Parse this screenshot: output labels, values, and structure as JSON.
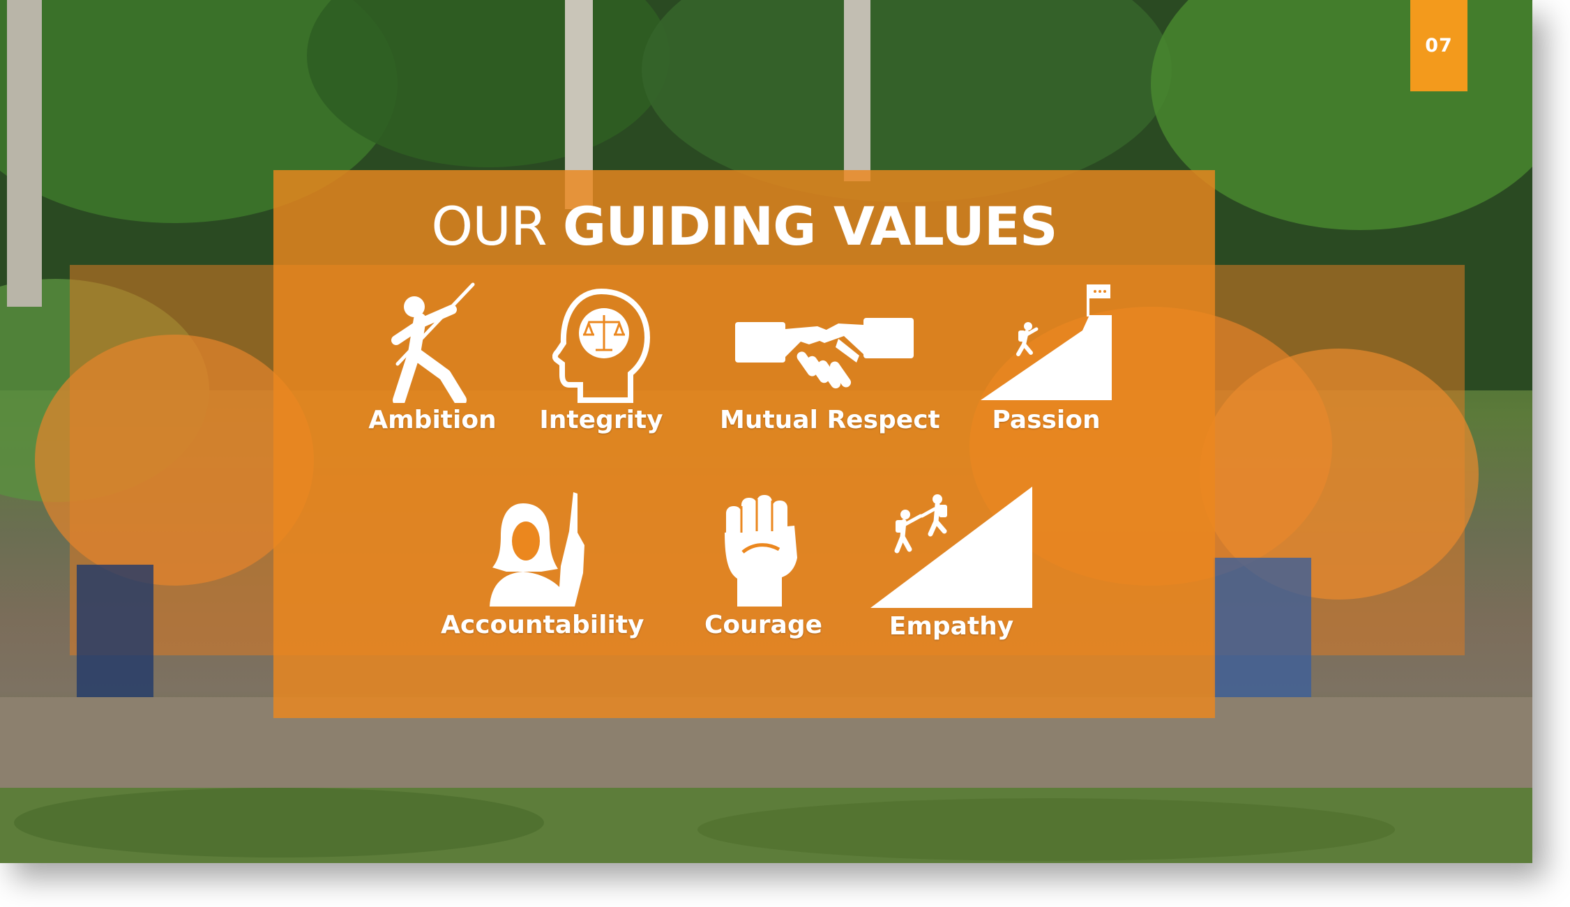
{
  "page_number": "07",
  "title": {
    "light": "OUR",
    "bold": "GUIDING VALUES"
  },
  "values": [
    {
      "label": "Ambition",
      "icon": "javelin-thrower-icon"
    },
    {
      "label": "Integrity",
      "icon": "head-with-scales-icon"
    },
    {
      "label": "Mutual Respect",
      "icon": "handshake-icon"
    },
    {
      "label": "Passion",
      "icon": "mountain-climber-icon"
    },
    {
      "label": "Accountability",
      "icon": "woman-raising-hand-icon"
    },
    {
      "label": "Courage",
      "icon": "raised-fist-icon"
    },
    {
      "label": "Empathy",
      "icon": "helping-climber-icon"
    }
  ],
  "colors": {
    "accent": "#f39a1c",
    "panel": "#eb871e",
    "text": "#ffffff"
  }
}
